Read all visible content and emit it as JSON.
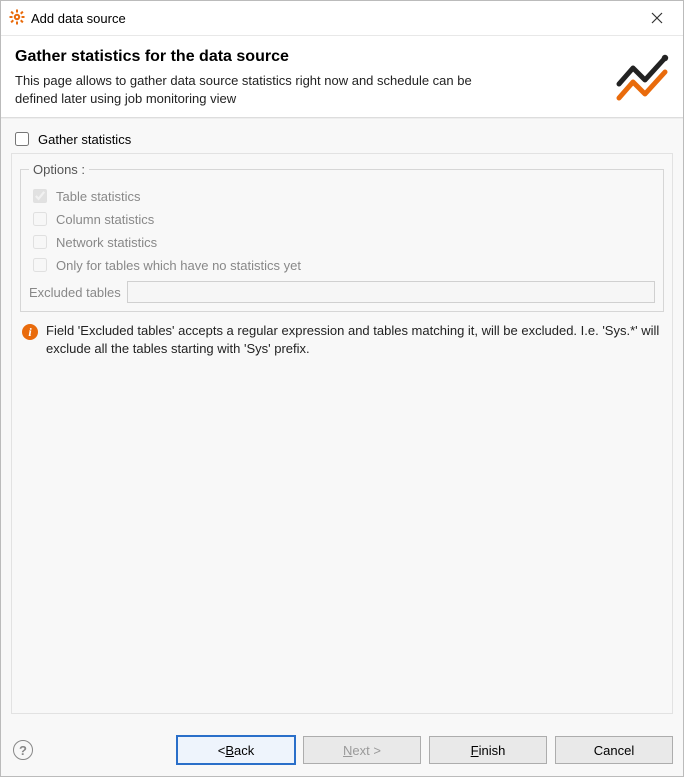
{
  "titlebar": {
    "title": "Add data source"
  },
  "header": {
    "title": "Gather statistics for the data source",
    "desc": "This page allows to gather data source statistics right now and schedule can be defined later using job monitoring view"
  },
  "gather_checkbox_label": "Gather statistics",
  "options_legend": "Options :",
  "options": {
    "table": "Table statistics",
    "column": "Column statistics",
    "network": "Network statistics",
    "only_new": "Only for tables which have no statistics yet"
  },
  "excluded_label": "Excluded tables",
  "excluded_value": "",
  "info_text": "Field 'Excluded tables' accepts a regular expression and tables matching it, will be excluded. I.e. 'Sys.*' will exclude all the tables starting with 'Sys' prefix.",
  "buttons": {
    "back_prefix": "< ",
    "back_letter": "B",
    "back_rest": "ack",
    "next_letter": "N",
    "next_rest": "ext >",
    "finish_letter": "F",
    "finish_rest": "inish",
    "cancel": "Cancel"
  }
}
